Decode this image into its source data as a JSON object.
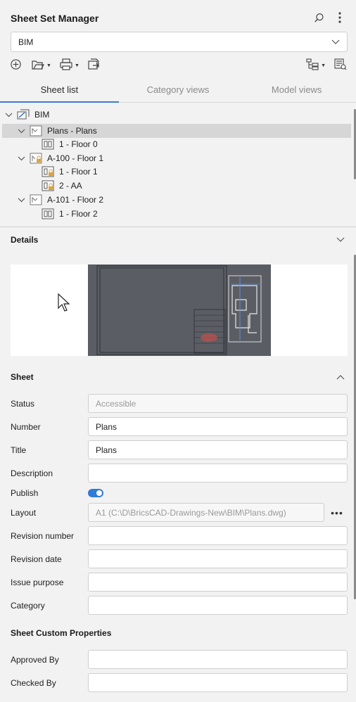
{
  "header": {
    "title": "Sheet Set Manager",
    "icons": [
      "search-icon",
      "more-vertical-icon"
    ]
  },
  "sheet_set_select": {
    "value": "BIM"
  },
  "toolbar": {
    "left": [
      "new-icon",
      "open-icon",
      "publish-icon",
      "export-icon"
    ],
    "right": [
      "tree-view-icon",
      "properties-icon"
    ]
  },
  "tabs": [
    {
      "label": "Sheet list",
      "active": true
    },
    {
      "label": "Category views",
      "active": false
    },
    {
      "label": "Model views",
      "active": false
    }
  ],
  "tree": [
    {
      "label": "BIM",
      "level": 0,
      "expanded": true,
      "icon": "sheet-set-icon"
    },
    {
      "label": "Plans - Plans",
      "level": 1,
      "expanded": true,
      "icon": "layout-icon",
      "selected": true
    },
    {
      "label": "1 - Floor 0",
      "level": 2,
      "icon": "view-icon"
    },
    {
      "label": "A-100 - Floor 1",
      "level": 1,
      "expanded": true,
      "icon": "layout-locked-icon"
    },
    {
      "label": "1 - Floor 1",
      "level": 2,
      "icon": "view-locked-icon"
    },
    {
      "label": "2 - AA",
      "level": 2,
      "icon": "view-locked-icon"
    },
    {
      "label": "A-101 - Floor 2",
      "level": 1,
      "expanded": true,
      "icon": "layout-icon"
    },
    {
      "label": "1 - Floor 2",
      "level": 2,
      "icon": "view-icon"
    }
  ],
  "details": {
    "title": "Details"
  },
  "sheet": {
    "title": "Sheet",
    "fields": [
      {
        "label": "Status",
        "value": "Accessible",
        "muted": true
      },
      {
        "label": "Number",
        "value": "Plans"
      },
      {
        "label": "Title",
        "value": "Plans"
      },
      {
        "label": "Description",
        "value": ""
      },
      {
        "label": "Publish",
        "toggle": true
      },
      {
        "label": "Layout",
        "value": "A1 (C:\\D\\BricsCAD-Drawings-New\\BIM\\Plans.dwg)",
        "muted": true,
        "more": "•••"
      },
      {
        "label": "Revision number",
        "value": ""
      },
      {
        "label": "Revision date",
        "value": ""
      },
      {
        "label": "Issue purpose",
        "value": ""
      },
      {
        "label": "Category",
        "value": ""
      }
    ]
  },
  "custom_properties": {
    "title": "Sheet Custom Properties",
    "fields": [
      {
        "label": "Approved By",
        "value": ""
      },
      {
        "label": "Checked By",
        "value": ""
      }
    ]
  }
}
